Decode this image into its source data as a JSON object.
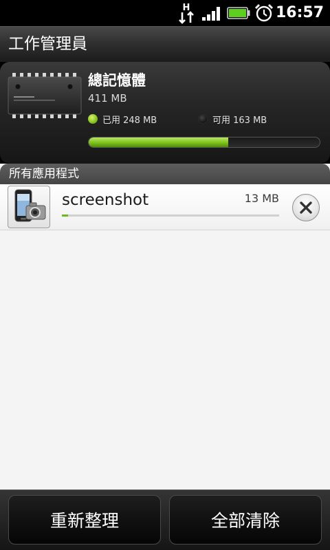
{
  "status_bar": {
    "network_letter": "H",
    "time": "16:57",
    "icons": [
      "hspa-data-icon",
      "signal-strength-icon",
      "battery-icon",
      "alarm-clock-icon"
    ]
  },
  "header": {
    "title": "工作管理員"
  },
  "memory": {
    "title": "總記憶體",
    "total": "411 MB",
    "used_label": "已用 248 MB",
    "free_label": "可用 163 MB",
    "used_fraction": 0.6034,
    "colors": {
      "used": "#7fc119",
      "free": "#151515"
    }
  },
  "section": {
    "label": "所有應用程式"
  },
  "apps": [
    {
      "name": "screenshot",
      "size": "13 MB",
      "memory_fraction": 0.03,
      "icon": "screenshot-app-icon"
    }
  ],
  "bottom_bar": {
    "refresh_label": "重新整理",
    "clear_all_label": "全部清除"
  }
}
